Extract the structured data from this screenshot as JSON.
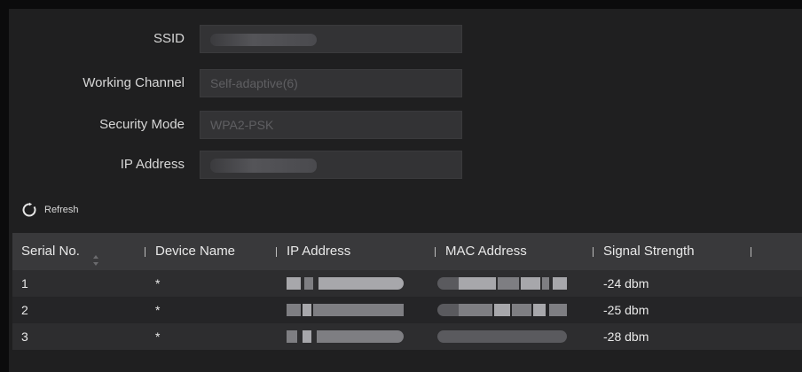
{
  "form": {
    "ssid_label": "SSID",
    "channel_label": "Working Channel",
    "channel_value": "Self-adaptive(6)",
    "security_label": "Security Mode",
    "security_value": "WPA2-PSK",
    "ip_label": "IP Address"
  },
  "refresh": {
    "icon": "refresh-icon",
    "label": "Refresh"
  },
  "table": {
    "headers": {
      "serial": "Serial No.",
      "device_name": "Device Name",
      "ip": "IP Address",
      "mac": "MAC Address",
      "signal": "Signal Strength"
    },
    "rows": [
      {
        "serial": "1",
        "device_name": "*",
        "signal": "-24 dbm"
      },
      {
        "serial": "2",
        "device_name": "*",
        "signal": "-25 dbm"
      },
      {
        "serial": "3",
        "device_name": "*",
        "signal": "-28 dbm"
      }
    ]
  },
  "colors": {
    "background": "#1f1f20",
    "header": "#39393b",
    "input": "#333335"
  }
}
